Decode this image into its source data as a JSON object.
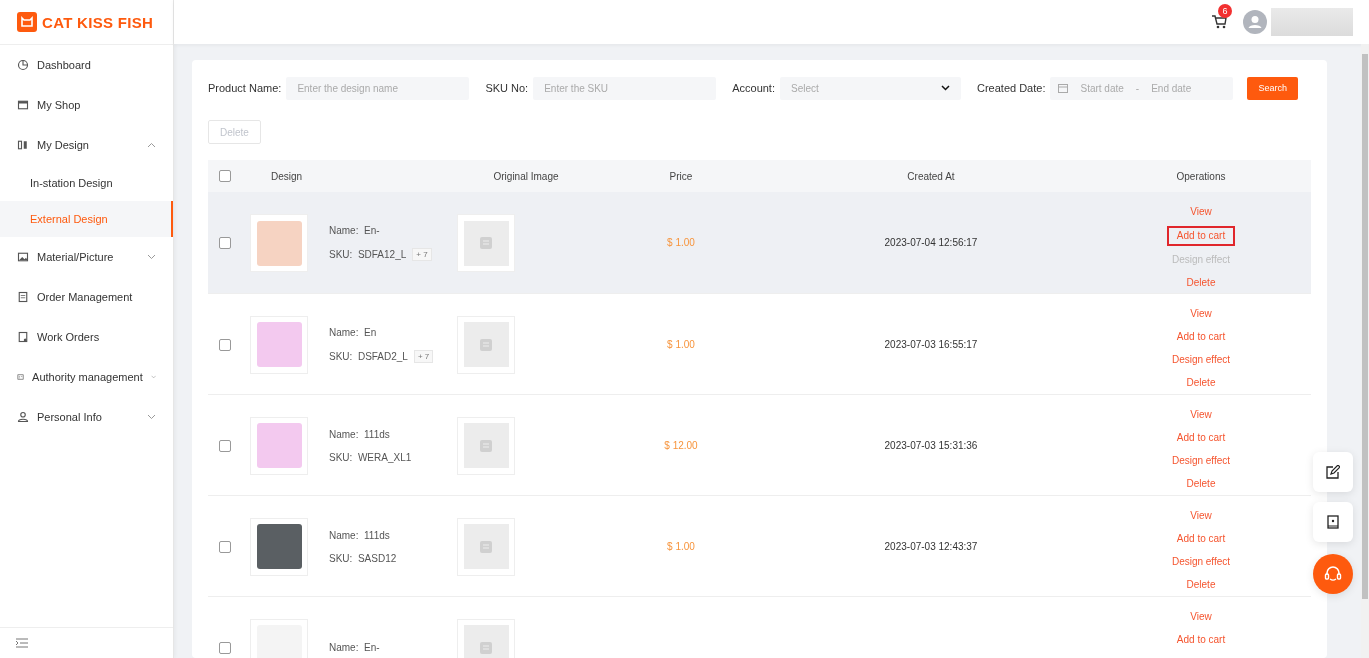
{
  "logo": {
    "text": "CAT KISS FISH"
  },
  "sidebar": {
    "items": [
      {
        "label": "Dashboard",
        "kind": "link"
      },
      {
        "label": "My Shop",
        "kind": "link"
      },
      {
        "label": "My Design",
        "kind": "group",
        "expanded": true,
        "children": [
          {
            "label": "In-station Design",
            "selected": false
          },
          {
            "label": "External Design",
            "selected": true
          }
        ]
      },
      {
        "label": "Material/Picture",
        "kind": "group",
        "expanded": false
      },
      {
        "label": "Order Management",
        "kind": "link"
      },
      {
        "label": "Work Orders",
        "kind": "link"
      },
      {
        "label": "Authority management",
        "kind": "group",
        "expanded": false
      },
      {
        "label": "Personal Info",
        "kind": "group",
        "expanded": false
      }
    ]
  },
  "header": {
    "cart_count": "6"
  },
  "filters": [
    {
      "kind": "text",
      "label": "Product Name:",
      "placeholder": "Enter the design name"
    },
    {
      "kind": "text",
      "label": "SKU No:",
      "placeholder": "Enter the SKU"
    },
    {
      "kind": "select",
      "label": "Account:",
      "placeholder": "Select"
    },
    {
      "kind": "daterange",
      "label": "Created Date:",
      "start_placeholder": "Start date",
      "separator": "-",
      "end_placeholder": "End date"
    }
  ],
  "search_button": "Search",
  "delete_button": {
    "label": "Delete",
    "disabled": true
  },
  "table": {
    "select_all_checked": false,
    "columns": [
      "Design",
      "Original Image",
      "Price",
      "Created At",
      "Operations"
    ],
    "rows": [
      {
        "checked": false,
        "highlighted": true,
        "thumb": {
          "kind": "illustration"
        },
        "name_label": "Name:",
        "name": "En-",
        "sku_label": "SKU:",
        "sku": "SDFA12_L",
        "sku_more": "+ 7",
        "price": "$ 1.00",
        "created_at": "2023-07-04 12:56:17",
        "operations": [
          {
            "label": "View",
            "disabled": false,
            "outlined": false
          },
          {
            "label": "Add to cart",
            "disabled": false,
            "outlined": true
          },
          {
            "label": "Design effect",
            "disabled": true,
            "outlined": false
          },
          {
            "label": "Delete",
            "disabled": false,
            "outlined": false
          }
        ]
      },
      {
        "checked": false,
        "highlighted": false,
        "thumb": {
          "kind": "product"
        },
        "name_label": "Name:",
        "name": "En",
        "sku_label": "SKU:",
        "sku": "DSFAD2_L",
        "sku_more": "+ 7",
        "price": "$ 1.00",
        "created_at": "2023-07-03 16:55:17",
        "operations": [
          {
            "label": "View",
            "disabled": false,
            "outlined": false
          },
          {
            "label": "Add to cart",
            "disabled": false,
            "outlined": false
          },
          {
            "label": "Design effect",
            "disabled": false,
            "outlined": false
          },
          {
            "label": "Delete",
            "disabled": false,
            "outlined": false
          }
        ]
      },
      {
        "checked": false,
        "highlighted": false,
        "thumb": {
          "kind": "product"
        },
        "name_label": "Name:",
        "name": "111ds",
        "sku_label": "SKU:",
        "sku": "WERA_XL1",
        "price": "$ 12.00",
        "created_at": "2023-07-03 15:31:36",
        "operations": [
          {
            "label": "View",
            "disabled": false,
            "outlined": false
          },
          {
            "label": "Add to cart",
            "disabled": false,
            "outlined": false
          },
          {
            "label": "Design effect",
            "disabled": false,
            "outlined": false
          },
          {
            "label": "Delete",
            "disabled": false,
            "outlined": false
          }
        ]
      },
      {
        "checked": false,
        "highlighted": false,
        "thumb": {
          "kind": "photo"
        },
        "name_label": "Name:",
        "name": "111ds",
        "sku_label": "SKU:",
        "sku": "SASD12",
        "price": "$ 1.00",
        "created_at": "2023-07-03 12:43:37",
        "operations": [
          {
            "label": "View",
            "disabled": false,
            "outlined": false
          },
          {
            "label": "Add to cart",
            "disabled": false,
            "outlined": false
          },
          {
            "label": "Design effect",
            "disabled": false,
            "outlined": false
          },
          {
            "label": "Delete",
            "disabled": false,
            "outlined": false
          }
        ]
      },
      {
        "checked": false,
        "highlighted": false,
        "thumb": {
          "kind": "screenshot"
        },
        "name_label": "Name:",
        "name": "En-",
        "operations": [
          {
            "label": "View",
            "disabled": false,
            "outlined": false
          },
          {
            "label": "Add to cart",
            "disabled": false,
            "outlined": false
          }
        ]
      }
    ]
  }
}
